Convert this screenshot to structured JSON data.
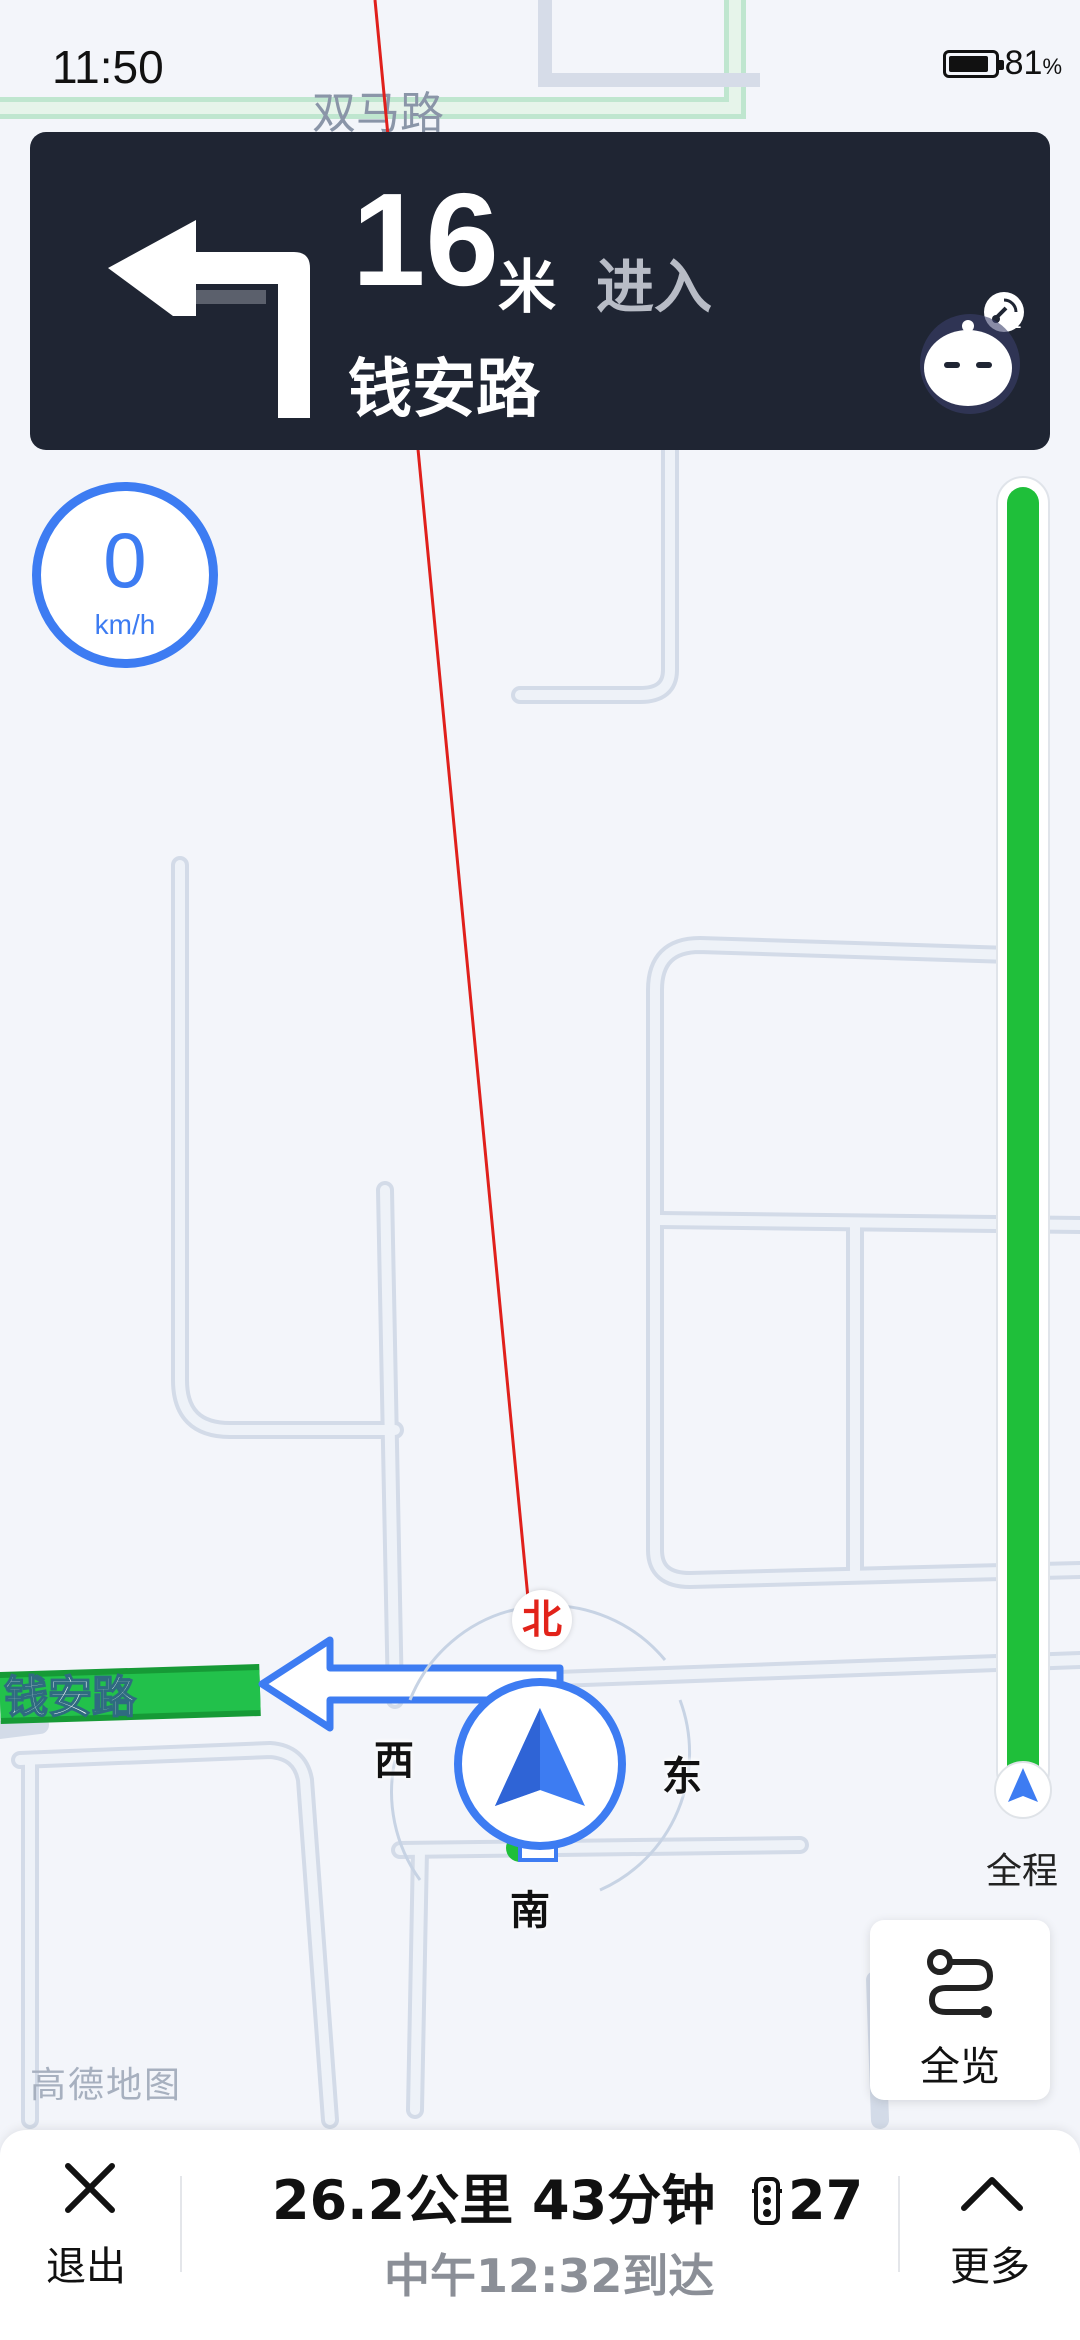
{
  "status_bar": {
    "time": "11:50",
    "battery_percent": "81",
    "battery_unit": "%"
  },
  "map": {
    "top_road_label": "双马路",
    "current_road_label": "钱安路",
    "brand_text": "高德地图"
  },
  "guidance": {
    "distance": "16",
    "unit": "米",
    "action": "进入",
    "road": "钱安路",
    "turn_icon": "turn-left-icon"
  },
  "speed": {
    "value": "0",
    "unit": "km/h"
  },
  "compass": {
    "north": "北",
    "south": "南",
    "east": "东",
    "west": "西"
  },
  "progress": {
    "label": "全程",
    "fill_fraction": 1.0
  },
  "overview": {
    "label": "全览",
    "icon": "route-overview-icon"
  },
  "bottom_bar": {
    "exit_label": "退出",
    "distance": "26.2公里",
    "duration": "43分钟",
    "traffic_lights": "27",
    "eta": "中午12:32到达",
    "more_label": "更多"
  },
  "colors": {
    "card_bg": "#1f2533",
    "accent_blue": "#3d7cf2",
    "route_green": "#1fbf3a",
    "north_red": "#e2231a"
  }
}
